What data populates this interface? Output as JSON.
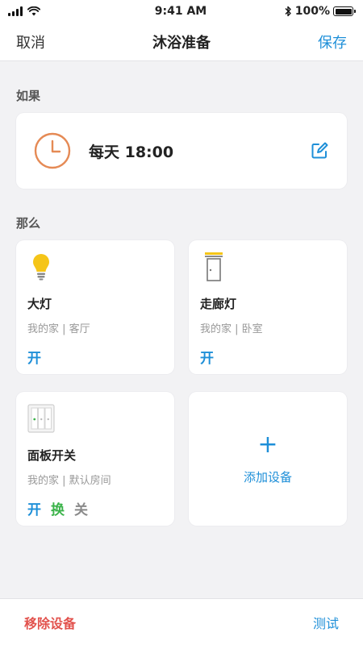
{
  "status_bar": {
    "time": "9:41 AM",
    "battery": "100%"
  },
  "nav": {
    "cancel": "取消",
    "title": "沐浴准备",
    "save": "保存"
  },
  "if_section": {
    "label": "如果",
    "trigger": "每天 18:00"
  },
  "then_section": {
    "label": "那么",
    "devices": [
      {
        "name": "大灯",
        "location": "我的家 | 客厅",
        "action": "开"
      },
      {
        "name": "走廊灯",
        "location": "我的家 | 卧室",
        "action": "开"
      },
      {
        "name": "面板开关",
        "location": "我的家 | 默认房间",
        "actions": [
          "开",
          "换",
          "关"
        ]
      }
    ],
    "add": {
      "plus": "+",
      "label": "添加设备"
    }
  },
  "bottom": {
    "remove": "移除设备",
    "test": "测试"
  },
  "colors": {
    "accent": "#1e8fd8",
    "danger": "#e2524d",
    "clock": "#e58a55",
    "bulb": "#f5c518",
    "green": "#3bb34a",
    "gray": "#8a8a8a"
  }
}
